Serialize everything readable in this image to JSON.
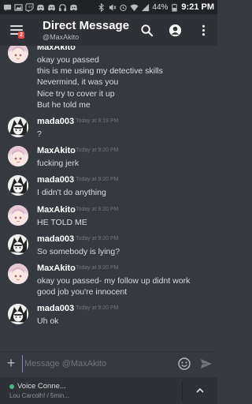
{
  "status_bar": {
    "battery": "44%",
    "time": "9:21 PM",
    "left_icons": [
      "chat-bubble-icon",
      "image-icon",
      "twitch-icon",
      "discord-icon",
      "discord-icon",
      "headphones-icon",
      "discord-icon"
    ],
    "right_icons": [
      "bluetooth-icon",
      "mute-icon",
      "alarm-icon",
      "wifi-icon",
      "signal-icon"
    ]
  },
  "header": {
    "title": "Direct Message",
    "subtitle": "@MaxAkito",
    "badge": "2"
  },
  "messages": [
    {
      "user": "MaxAkito",
      "time": "",
      "avatar": "maxakito",
      "lines": [
        "okay you passed",
        "this is me using my detective skills",
        "Nevermind, it was you",
        "Nice try to cover it up",
        "But he told me"
      ]
    },
    {
      "user": "mada003",
      "time": "Today at 9:19 PM",
      "avatar": "mada003",
      "lines": [
        "?"
      ]
    },
    {
      "user": "MaxAkito",
      "time": "Today at 9:20 PM",
      "avatar": "maxakito",
      "lines": [
        "fucking jerk"
      ]
    },
    {
      "user": "mada003",
      "time": "Today at 9:20 PM",
      "avatar": "mada003",
      "lines": [
        "I didn't do anything"
      ]
    },
    {
      "user": "MaxAkito",
      "time": "Today at 9:20 PM",
      "avatar": "maxakito",
      "lines": [
        "HE TOLD ME"
      ]
    },
    {
      "user": "mada003",
      "time": "Today at 9:20 PM",
      "avatar": "mada003",
      "lines": [
        "So somebody is lying?"
      ]
    },
    {
      "user": "MaxAkito",
      "time": "Today at 9:20 PM",
      "avatar": "maxakito",
      "lines": [
        "okay you passed- my follow up didnt work",
        "good job you're innocent"
      ]
    },
    {
      "user": "mada003",
      "time": "Today at 9:20 PM",
      "avatar": "mada003",
      "lines": [
        "Uh ok"
      ]
    }
  ],
  "compose": {
    "placeholder": "Message @MaxAkito"
  },
  "voice": {
    "title": "Voice Conne...",
    "subtitle": "Lou Carcolh! / 5min..."
  },
  "colors": {
    "background": "#36393f",
    "header": "#2f3136",
    "accent": "#7289da",
    "online": "#43b581",
    "badge": "#f04747"
  }
}
